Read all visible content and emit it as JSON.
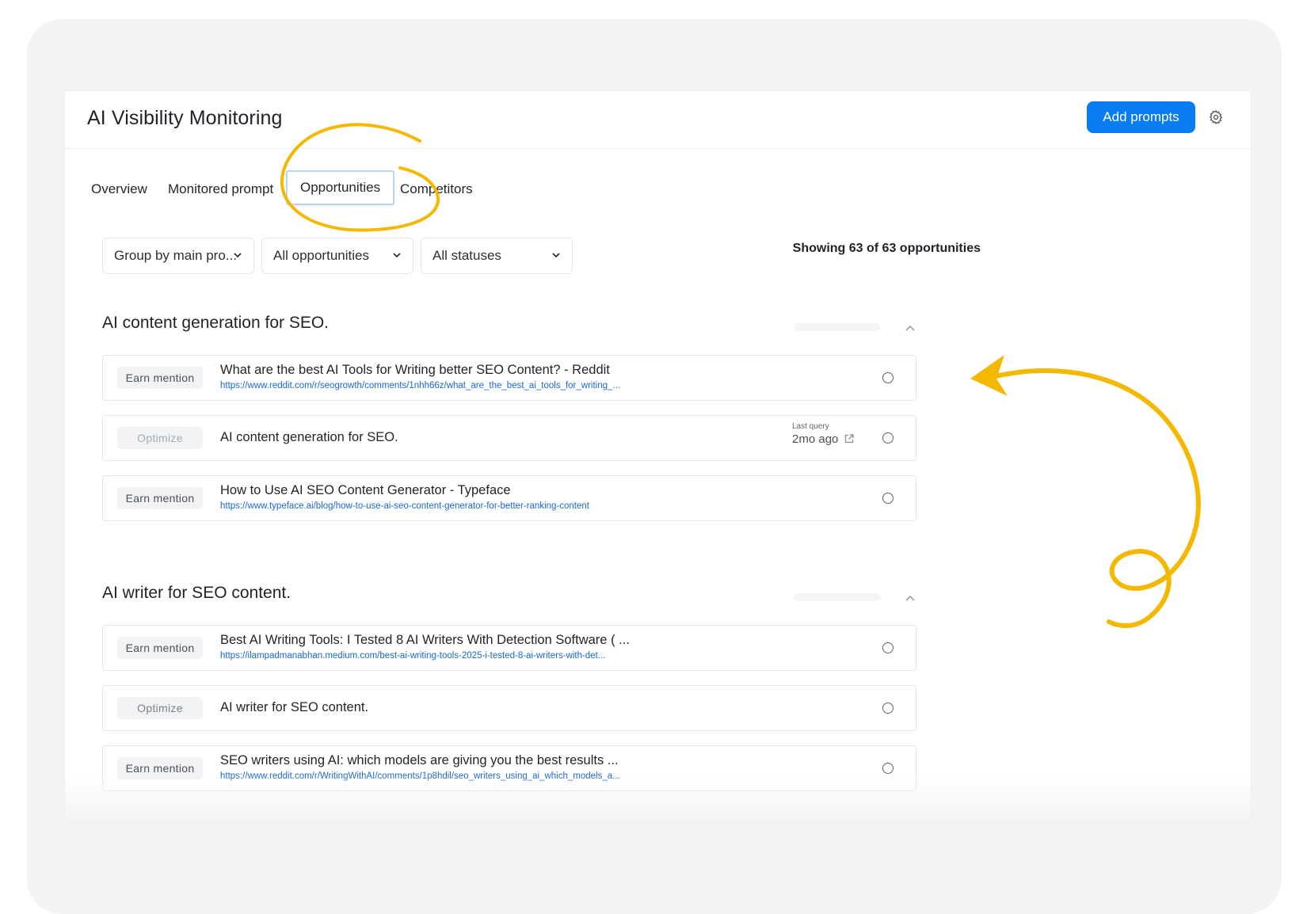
{
  "header": {
    "title": "AI Visibility Monitoring",
    "add_button": "Add prompts",
    "settings_icon": "gear-icon"
  },
  "tabs": [
    {
      "label": "Overview",
      "active": false
    },
    {
      "label": "Monitored prompt",
      "active": false
    },
    {
      "label": "Opportunities",
      "active": true
    },
    {
      "label": "Competitors",
      "active": false
    }
  ],
  "filters": [
    {
      "label": "Group by main pro..."
    },
    {
      "label": "All opportunities"
    },
    {
      "label": "All statuses"
    }
  ],
  "showing_text": "Showing 63 of 63 opportunities",
  "groups": [
    {
      "title": "AI content generation for SEO.",
      "rows": [
        {
          "badge": "Earn mention",
          "title": "What are the best AI Tools for Writing better SEO Content? - Reddit",
          "url": "https://www.reddit.com/r/seogrowth/comments/1nhh66z/what_are_the_best_ai_tools_for_writing_..."
        },
        {
          "badge": "Optimize",
          "title": "AI content generation for SEO.",
          "last_query_label": "Last query",
          "last_query_value": "2mo ago"
        },
        {
          "badge": "Earn mention",
          "title": "How to Use AI SEO Content Generator - Typeface",
          "url": "https://www.typeface.ai/blog/how-to-use-ai-seo-content-generator-for-better-ranking-content"
        }
      ]
    },
    {
      "title": "AI writer for SEO content.",
      "rows": [
        {
          "badge": "Earn mention",
          "title": "Best AI Writing Tools: I Tested 8 AI Writers With Detection Software ( ...",
          "url": "https://ilampadmanabhan.medium.com/best-ai-writing-tools-2025-i-tested-8-ai-writers-with-det..."
        },
        {
          "badge": "Optimize",
          "title": "AI writer for SEO content."
        },
        {
          "badge": "Earn mention",
          "title": "SEO writers using AI: which models are giving you the best results ...",
          "url": "https://www.reddit.com/r/WritingWithAI/comments/1p8hdil/seo_writers_using_ai_which_models_a..."
        }
      ]
    }
  ],
  "colors": {
    "accent": "#0a7cf2",
    "link": "#1967d2",
    "annotation": "#f5b800"
  }
}
